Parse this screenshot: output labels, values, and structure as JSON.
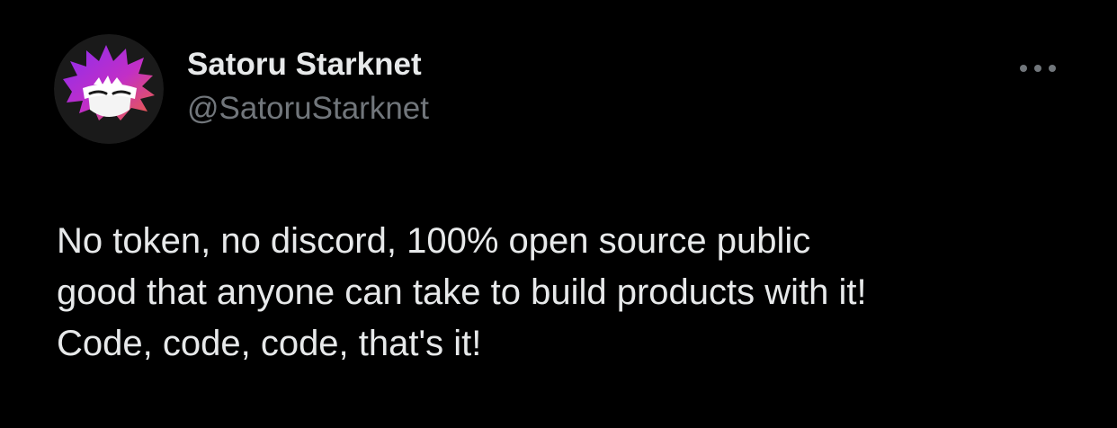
{
  "tweet": {
    "author": {
      "display_name": "Satoru Starknet",
      "handle": "@SatoruStarknet",
      "avatar_icon": "spiky-masked-head-avatar-icon"
    },
    "more_icon": "more-horizontal-icon",
    "lines": [
      "No token, no discord, 100% open source public",
      "good that anyone can take to build products with it!",
      "Code, code, code, that's it!"
    ]
  },
  "colors": {
    "background": "#000000",
    "primary_text": "#e7e9ea",
    "secondary_text": "#71767b",
    "avatar_bg": "#1a1a1a",
    "avatar_purple": "#8b2cf0",
    "avatar_pink": "#e8328c",
    "avatar_orange": "#f0623a"
  }
}
